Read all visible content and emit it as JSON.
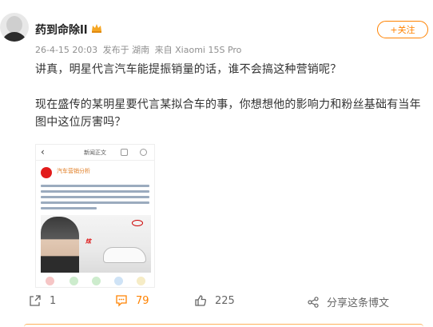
{
  "post": {
    "username": "药到命除ll",
    "date": "26-4-15 20:03",
    "location": "发布于 湖南",
    "source": "来自 Xiaomi 15S Pro",
    "follow_label": "+关注",
    "paragraph_1": "讲真，明星代言汽车能提振销量的话，谁不会搞这种营销呢？",
    "paragraph_2": "现在盛传的某明星要代言某拟合车的事，你想想他的影响力和粉丝基础有当年图中这位厉害吗？"
  },
  "embedded_image": {
    "nav_title": "新闻正文",
    "source_name": "汽车营销分析",
    "ad_slogan": "炫",
    "colors": {
      "brand_red": "#e21b1b"
    }
  },
  "actions": {
    "share_count": "1",
    "comment_count": "79",
    "like_count": "225",
    "more_label": "分享这条博文"
  },
  "colors": {
    "accent": "#ff8200",
    "meta_gray": "#8f8f8f"
  }
}
